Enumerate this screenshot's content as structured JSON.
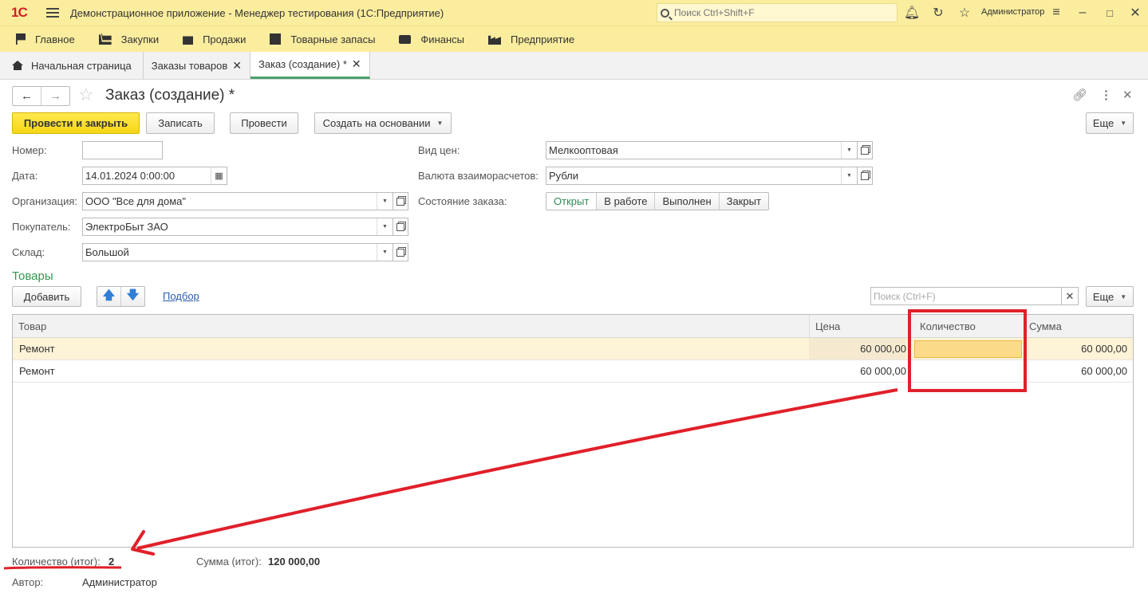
{
  "titlebar": {
    "logo": "1С",
    "app_title": "Демонстрационное приложение  - Менеджер тестирования (1С:Предприятие)",
    "search_placeholder": "Поиск Ctrl+Shift+F",
    "user": "Администратор"
  },
  "menu": [
    {
      "label": "Главное",
      "icon": "flag-icon"
    },
    {
      "label": "Закупки",
      "icon": "cart-icon"
    },
    {
      "label": "Продажи",
      "icon": "bag-icon"
    },
    {
      "label": "Товарные запасы",
      "icon": "stock-icon"
    },
    {
      "label": "Финансы",
      "icon": "wallet-icon"
    },
    {
      "label": "Предприятие",
      "icon": "factory-icon"
    }
  ],
  "tabs": [
    {
      "label": "Начальная страница",
      "closable": false
    },
    {
      "label": "Заказы товаров",
      "closable": true
    },
    {
      "label": "Заказ (создание) *",
      "closable": true,
      "active": true
    }
  ],
  "form": {
    "title": "Заказ (создание) *",
    "buttons": {
      "post_close": "Провести и закрыть",
      "save": "Записать",
      "post": "Провести",
      "create_based": "Создать на основании",
      "more": "Еще"
    },
    "fields": {
      "number_label": "Номер:",
      "number_value": "",
      "date_label": "Дата:",
      "date_value": "14.01.2024  0:00:00",
      "org_label": "Организация:",
      "org_value": "ООО \"Все для дома\"",
      "buyer_label": "Покупатель:",
      "buyer_value": "ЭлектроБыт ЗАО",
      "warehouse_label": "Склад:",
      "warehouse_value": "Большой",
      "price_type_label": "Вид цен:",
      "price_type_value": "Мелкооптовая",
      "currency_label": "Валюта взаиморасчетов:",
      "currency_value": "Рубли",
      "state_label": "Состояние заказа:"
    },
    "states": [
      "Открыт",
      "В работе",
      "Выполнен",
      "Закрыт"
    ]
  },
  "goods": {
    "title": "Товары",
    "add": "Добавить",
    "pick": "Подбор",
    "search_placeholder": "Поиск (Ctrl+F)",
    "more": "Еще",
    "columns": [
      "Товар",
      "Цена",
      "Количество",
      "Сумма"
    ],
    "rows": [
      {
        "item": "Ремонт",
        "price": "60 000,00",
        "qty": "",
        "sum": "60 000,00"
      },
      {
        "item": "Ремонт",
        "price": "60 000,00",
        "qty": "",
        "sum": "60 000,00"
      }
    ]
  },
  "footer": {
    "qty_label": "Количество (итог):",
    "qty_value": "2",
    "sum_label": "Сумма (итог):",
    "sum_value": "120 000,00",
    "author_label": "Автор:",
    "author_value": "Администратор"
  },
  "colors": {
    "annotation": "#e0202a",
    "accent_green": "#2e9a4e",
    "titlebar": "#fbed9e"
  }
}
